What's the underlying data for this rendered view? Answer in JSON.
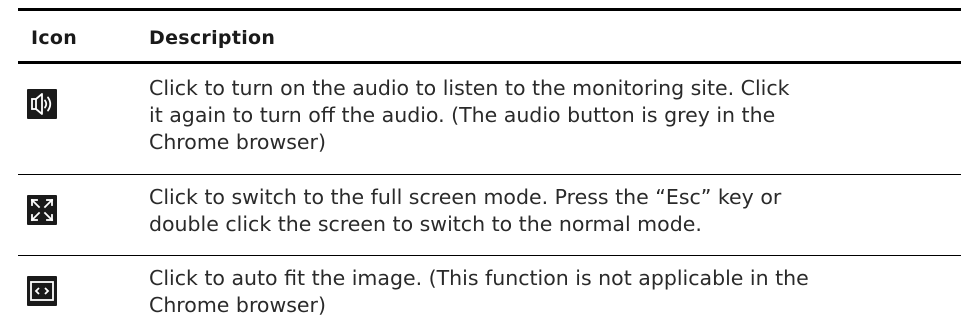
{
  "table": {
    "headers": {
      "icon": "Icon",
      "description": "Description"
    },
    "rows": [
      {
        "icon": "speaker-audio-icon",
        "description_lines": [
          "Click to turn on the audio to listen to the monitoring site. Click",
          "it again to turn off the audio. (The audio button is grey in the",
          "Chrome browser)"
        ]
      },
      {
        "icon": "fullscreen-expand-icon",
        "description_lines": [
          "Click to switch to the full screen mode. Press the “Esc” key or",
          "double click the screen to switch to the normal mode."
        ]
      },
      {
        "icon": "auto-fit-icon",
        "description_lines": [
          "Click to auto fit the image.   (This function is not applicable in the",
          "Chrome browser)"
        ]
      }
    ]
  }
}
